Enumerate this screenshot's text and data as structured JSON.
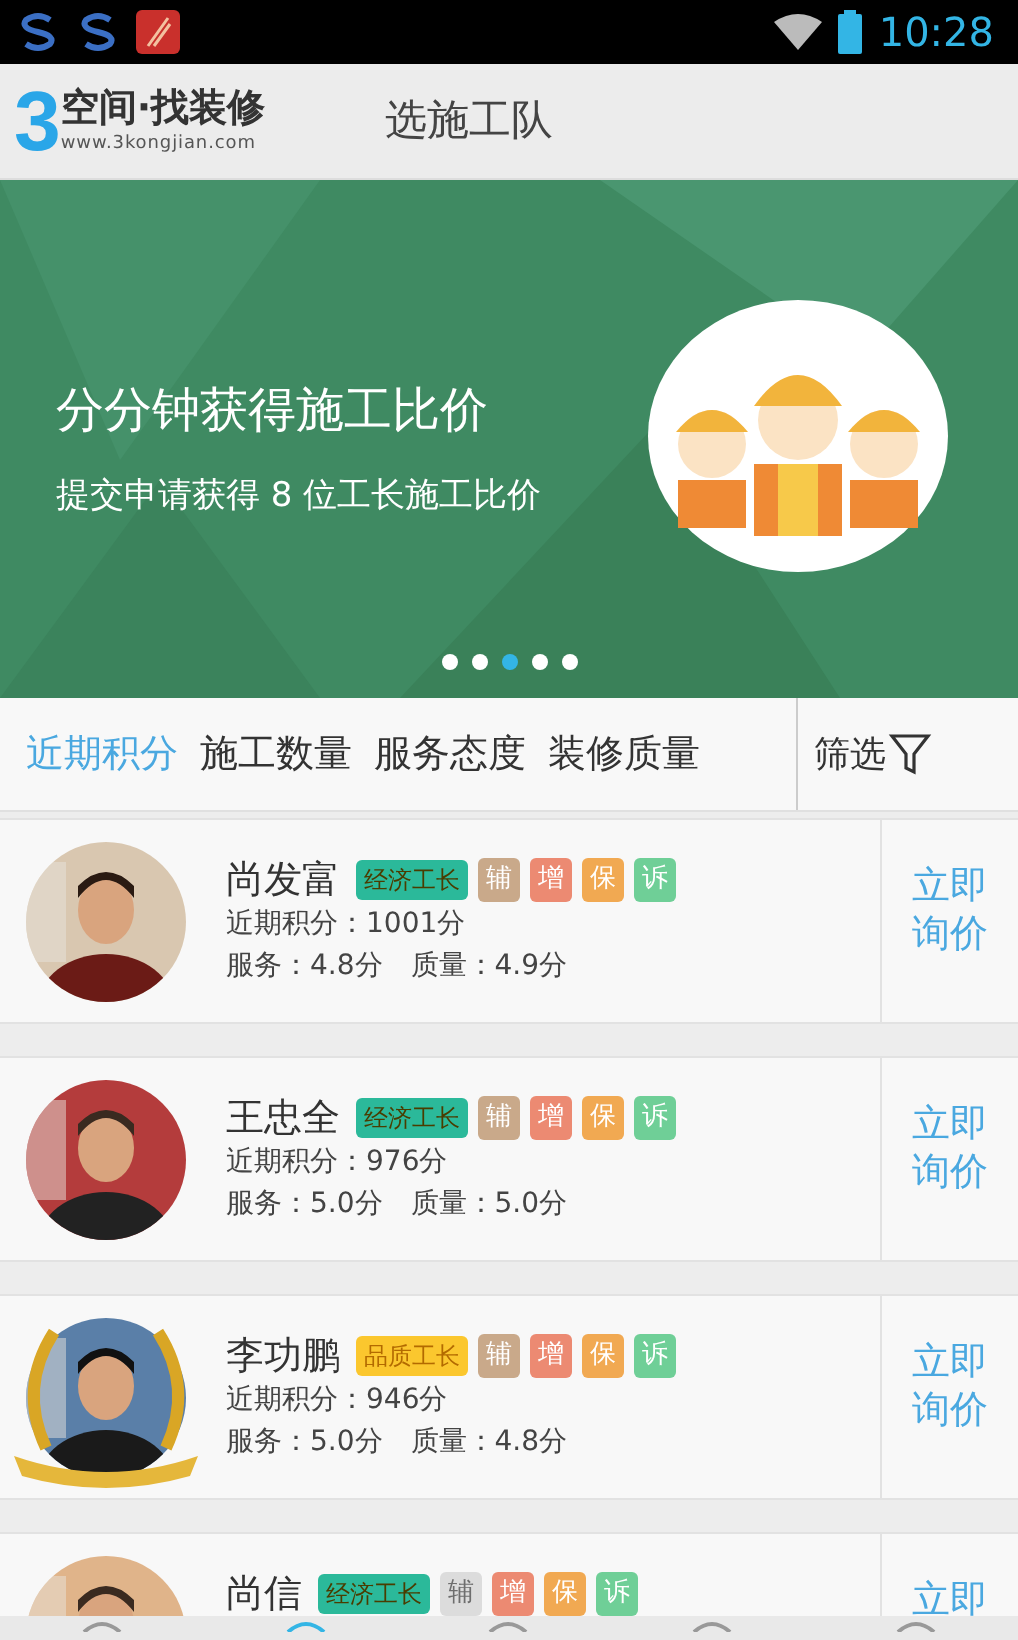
{
  "status_bar": {
    "time": "10:28"
  },
  "header": {
    "logo_mark": "3",
    "logo_name": "空间·找装修",
    "logo_url": "www.3kongjian.com",
    "title": "选施工队"
  },
  "banner": {
    "headline": "分分钟获得施工比价",
    "subline": "提交申请获得 8 位工长施工比价",
    "dots": [
      {
        "selected": false
      },
      {
        "selected": false
      },
      {
        "selected": true
      },
      {
        "selected": false
      },
      {
        "selected": false
      }
    ]
  },
  "sort_tabs": [
    {
      "label": "近期积分",
      "selected": true
    },
    {
      "label": "施工数量",
      "selected": false
    },
    {
      "label": "服务态度",
      "selected": false
    },
    {
      "label": "装修质量",
      "selected": false
    }
  ],
  "filter": {
    "label": "筛选"
  },
  "foremen": [
    {
      "name": "尚发富",
      "laurel": false,
      "grade": {
        "label": "经济工长",
        "color": "#2bb99a"
      },
      "tags": [
        {
          "label": "辅",
          "kind": "assist",
          "disabled": false
        },
        {
          "label": "增",
          "kind": "extra",
          "disabled": false
        },
        {
          "label": "保",
          "kind": "warranty",
          "disabled": false
        },
        {
          "label": "诉",
          "kind": "complaint",
          "disabled": false
        }
      ],
      "score": "近期积分：1001分",
      "ratings": [
        "服务：4.8分",
        "质量：4.9分"
      ],
      "action": "立即询价"
    },
    {
      "name": "王忠全",
      "laurel": false,
      "grade": {
        "label": "经济工长",
        "color": "#2bb99a"
      },
      "tags": [
        {
          "label": "辅",
          "kind": "assist",
          "disabled": false
        },
        {
          "label": "增",
          "kind": "extra",
          "disabled": false
        },
        {
          "label": "保",
          "kind": "warranty",
          "disabled": false
        },
        {
          "label": "诉",
          "kind": "complaint",
          "disabled": false
        }
      ],
      "score": "近期积分：976分",
      "ratings": [
        "服务：5.0分",
        "质量：5.0分"
      ],
      "action": "立即询价"
    },
    {
      "name": "李功鹏",
      "laurel": true,
      "grade": {
        "label": "品质工长",
        "color": "#fbc72e"
      },
      "tags": [
        {
          "label": "辅",
          "kind": "assist",
          "disabled": false
        },
        {
          "label": "增",
          "kind": "extra",
          "disabled": false
        },
        {
          "label": "保",
          "kind": "warranty",
          "disabled": false
        },
        {
          "label": "诉",
          "kind": "complaint",
          "disabled": false
        }
      ],
      "score": "近期积分：946分",
      "ratings": [
        "服务：5.0分",
        "质量：4.8分"
      ],
      "action": "立即询价"
    },
    {
      "name": "尚信",
      "laurel": false,
      "grade": {
        "label": "经济工长",
        "color": "#2bb99a"
      },
      "tags": [
        {
          "label": "辅",
          "kind": "assist",
          "disabled": true
        },
        {
          "label": "增",
          "kind": "extra",
          "disabled": false
        },
        {
          "label": "保",
          "kind": "warranty",
          "disabled": false
        },
        {
          "label": "诉",
          "kind": "complaint",
          "disabled": false
        }
      ],
      "action": "立即"
    }
  ]
}
